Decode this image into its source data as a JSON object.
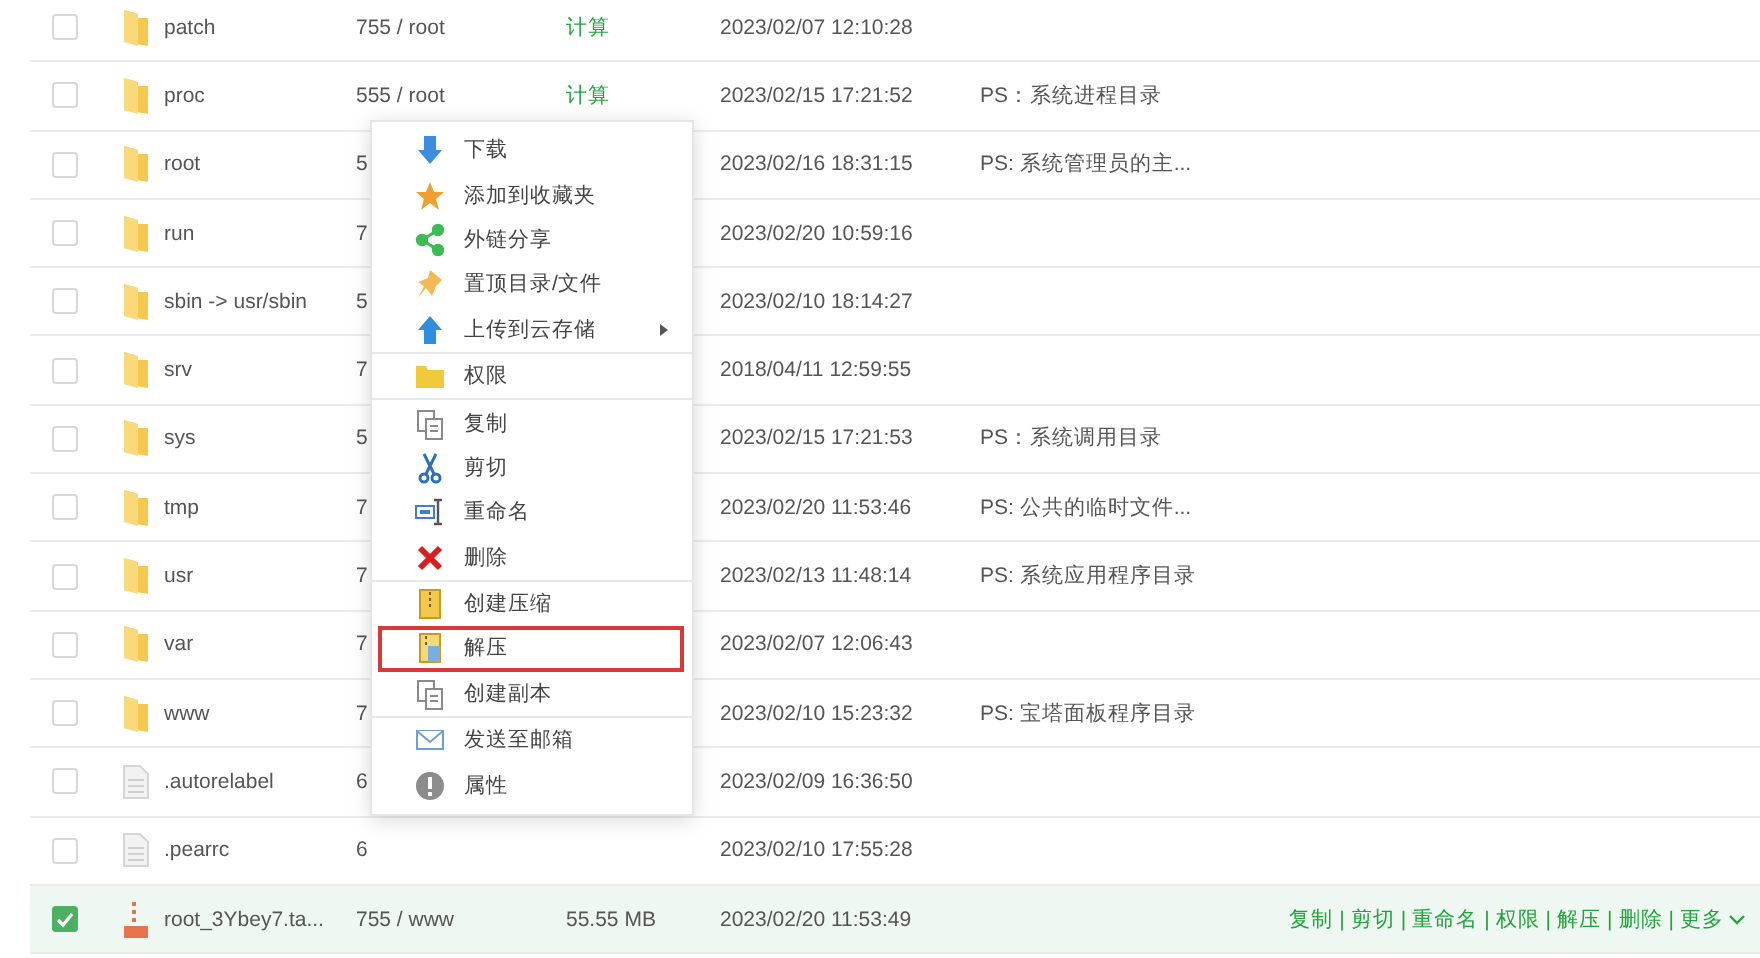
{
  "rows": [
    {
      "kind": "folder",
      "name": "patch",
      "checked": false,
      "permission": "755 / root",
      "calc": "计算",
      "date": "2023/02/07 12:10:28"
    },
    {
      "kind": "folder",
      "name": "proc",
      "checked": false,
      "permission": "555 / root",
      "calc": "计算",
      "date": "2023/02/15 17:21:52",
      "ps": "PS：系统进程目录"
    },
    {
      "kind": "folder",
      "name": "root",
      "checked": false,
      "permission": "5",
      "date": "2023/02/16 18:31:15",
      "ps": "PS: 系统管理员的主..."
    },
    {
      "kind": "folder",
      "name": "run",
      "checked": false,
      "permission": "7",
      "date": "2023/02/20 10:59:16"
    },
    {
      "kind": "folder",
      "name": "sbin -> usr/sbin",
      "checked": false,
      "permission": "5",
      "date": "2023/02/10 18:14:27"
    },
    {
      "kind": "folder",
      "name": "srv",
      "checked": false,
      "permission": "7",
      "date": "2018/04/11 12:59:55"
    },
    {
      "kind": "folder",
      "name": "sys",
      "checked": false,
      "permission": "5",
      "date": "2023/02/15 17:21:53",
      "ps": "PS：系统调用目录"
    },
    {
      "kind": "folder",
      "name": "tmp",
      "checked": false,
      "permission": "7",
      "date": "2023/02/20 11:53:46",
      "ps": "PS: 公共的临时文件..."
    },
    {
      "kind": "folder",
      "name": "usr",
      "checked": false,
      "permission": "7",
      "date": "2023/02/13 11:48:14",
      "ps": "PS: 系统应用程序目录"
    },
    {
      "kind": "folder",
      "name": "var",
      "checked": false,
      "permission": "7",
      "date": "2023/02/07 12:06:43"
    },
    {
      "kind": "folder",
      "name": "www",
      "checked": false,
      "permission": "7",
      "date": "2023/02/10 15:23:32",
      "ps": "PS: 宝塔面板程序目录"
    },
    {
      "kind": "file",
      "name": ".autorelabel",
      "checked": false,
      "permission": "6",
      "date": "2023/02/09 16:36:50"
    },
    {
      "kind": "file",
      "name": ".pearrc",
      "checked": false,
      "permission": "6",
      "date": "2023/02/10 17:55:28"
    },
    {
      "kind": "archive",
      "name": "root_3Ybey7.ta...",
      "checked": true,
      "permission": "755 / www",
      "size": "55.55 MB",
      "date": "2023/02/20 11:53:49",
      "separator": "|",
      "actions": [
        "复制",
        "剪切",
        "重命名",
        "权限",
        "解压",
        "删除",
        "更多"
      ]
    }
  ],
  "context_menu": {
    "groups": [
      [
        {
          "kind": "download",
          "label": "下载",
          "highlighted": false
        },
        {
          "kind": "star",
          "label": "添加到收藏夹",
          "highlighted": false
        },
        {
          "kind": "share",
          "label": "外链分享",
          "highlighted": false
        },
        {
          "kind": "pin",
          "label": "置顶目录/文件",
          "highlighted": false
        },
        {
          "kind": "upload",
          "label": "上传到云存储",
          "highlighted": false,
          "submenu": true
        }
      ],
      [
        {
          "kind": "folder",
          "label": "权限",
          "highlighted": false
        }
      ],
      [
        {
          "kind": "copy",
          "label": "复制",
          "highlighted": false
        },
        {
          "kind": "cut",
          "label": "剪切",
          "highlighted": false
        },
        {
          "kind": "rename",
          "label": "重命名",
          "highlighted": false
        },
        {
          "kind": "delete",
          "label": "删除",
          "highlighted": false
        }
      ],
      [
        {
          "kind": "zip",
          "label": "创建压缩",
          "highlighted": false
        },
        {
          "kind": "unzip",
          "label": "解压",
          "highlighted": true
        },
        {
          "kind": "copy",
          "label": "创建副本",
          "highlighted": false
        }
      ],
      [
        {
          "kind": "mail",
          "label": "发送至邮箱",
          "highlighted": false
        },
        {
          "kind": "info",
          "label": "属性",
          "highlighted": false
        }
      ]
    ]
  }
}
